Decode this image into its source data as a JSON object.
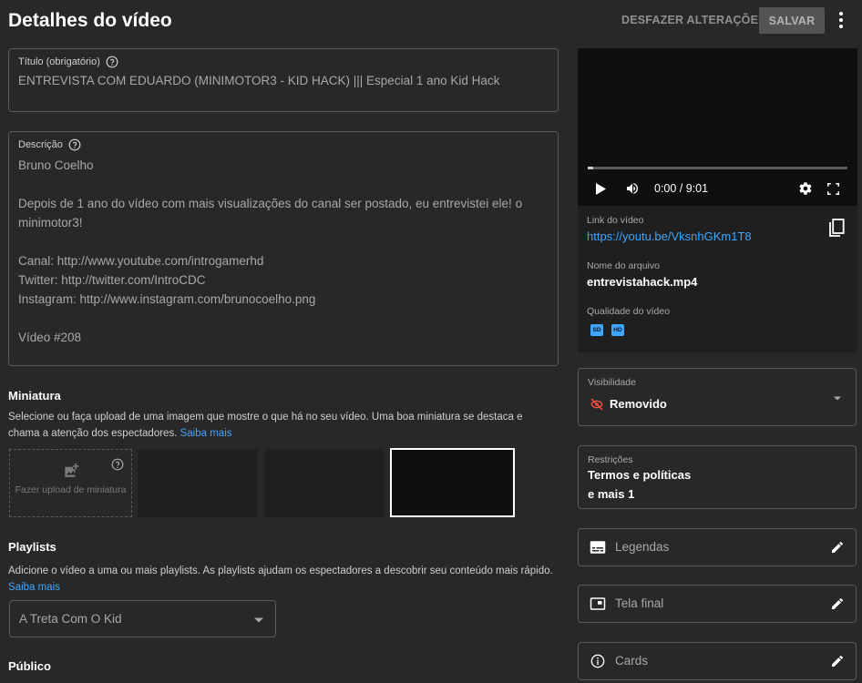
{
  "header": {
    "title": "Detalhes do vídeo",
    "undo_label": "DESFAZER ALTERAÇÕES",
    "save_label": "SALVAR"
  },
  "title_field": {
    "label": "Título (obrigatório)",
    "value": "ENTREVISTA COM EDUARDO (MINIMOTOR3 - KID HACK) ||| Especial 1 ano Kid Hack"
  },
  "description_field": {
    "label": "Descrição",
    "value": "Bruno Coelho\n\nDepois de 1 ano do vídeo com mais visualizações do canal ser postado, eu entrevistei ele! o minimotor3!\n\nCanal: http://www.youtube.com/introgamerhd\nTwitter: http://twitter.com/IntroCDC\nInstagram: http://www.instagram.com/brunocoelho.png\n\nVídeo #208"
  },
  "thumbnail": {
    "title": "Miniatura",
    "description": "Selecione ou faça upload de uma imagem que mostre o que há no seu vídeo. Uma boa miniatura se destaca e chama a atenção dos espectadores.",
    "learn_more": "Saiba mais",
    "upload_label": "Fazer upload de miniatura"
  },
  "playlists": {
    "title": "Playlists",
    "description": "Adicione o vídeo a uma ou mais playlists. As playlists ajudam os espectadores a descobrir seu conteúdo mais rápido.",
    "learn_more": "Saiba mais",
    "selected": "A Treta Com O Kid"
  },
  "audience": {
    "title": "Público"
  },
  "player": {
    "time": "0:00 / 9:01",
    "progress": 0.02
  },
  "video_info": {
    "link_label": "Link do vídeo",
    "link_value": "https://youtu.be/VksnhGKm1T8",
    "filename_label": "Nome do arquivo",
    "filename_value": "entrevistahack.mp4",
    "quality_label": "Qualidade do vídeo",
    "quality_badges": [
      "SD",
      "HD"
    ]
  },
  "visibility": {
    "label": "Visibilidade",
    "value": "Removido"
  },
  "restrictions": {
    "label": "Restrições",
    "line1": "Termos e políticas",
    "line2": "e mais 1"
  },
  "extras": {
    "subtitles": "Legendas",
    "end_screen": "Tela final",
    "cards": "Cards"
  },
  "colors": {
    "background": "#282828",
    "accent": "#3ea6ff",
    "removed_icon": "#ff4e45"
  }
}
